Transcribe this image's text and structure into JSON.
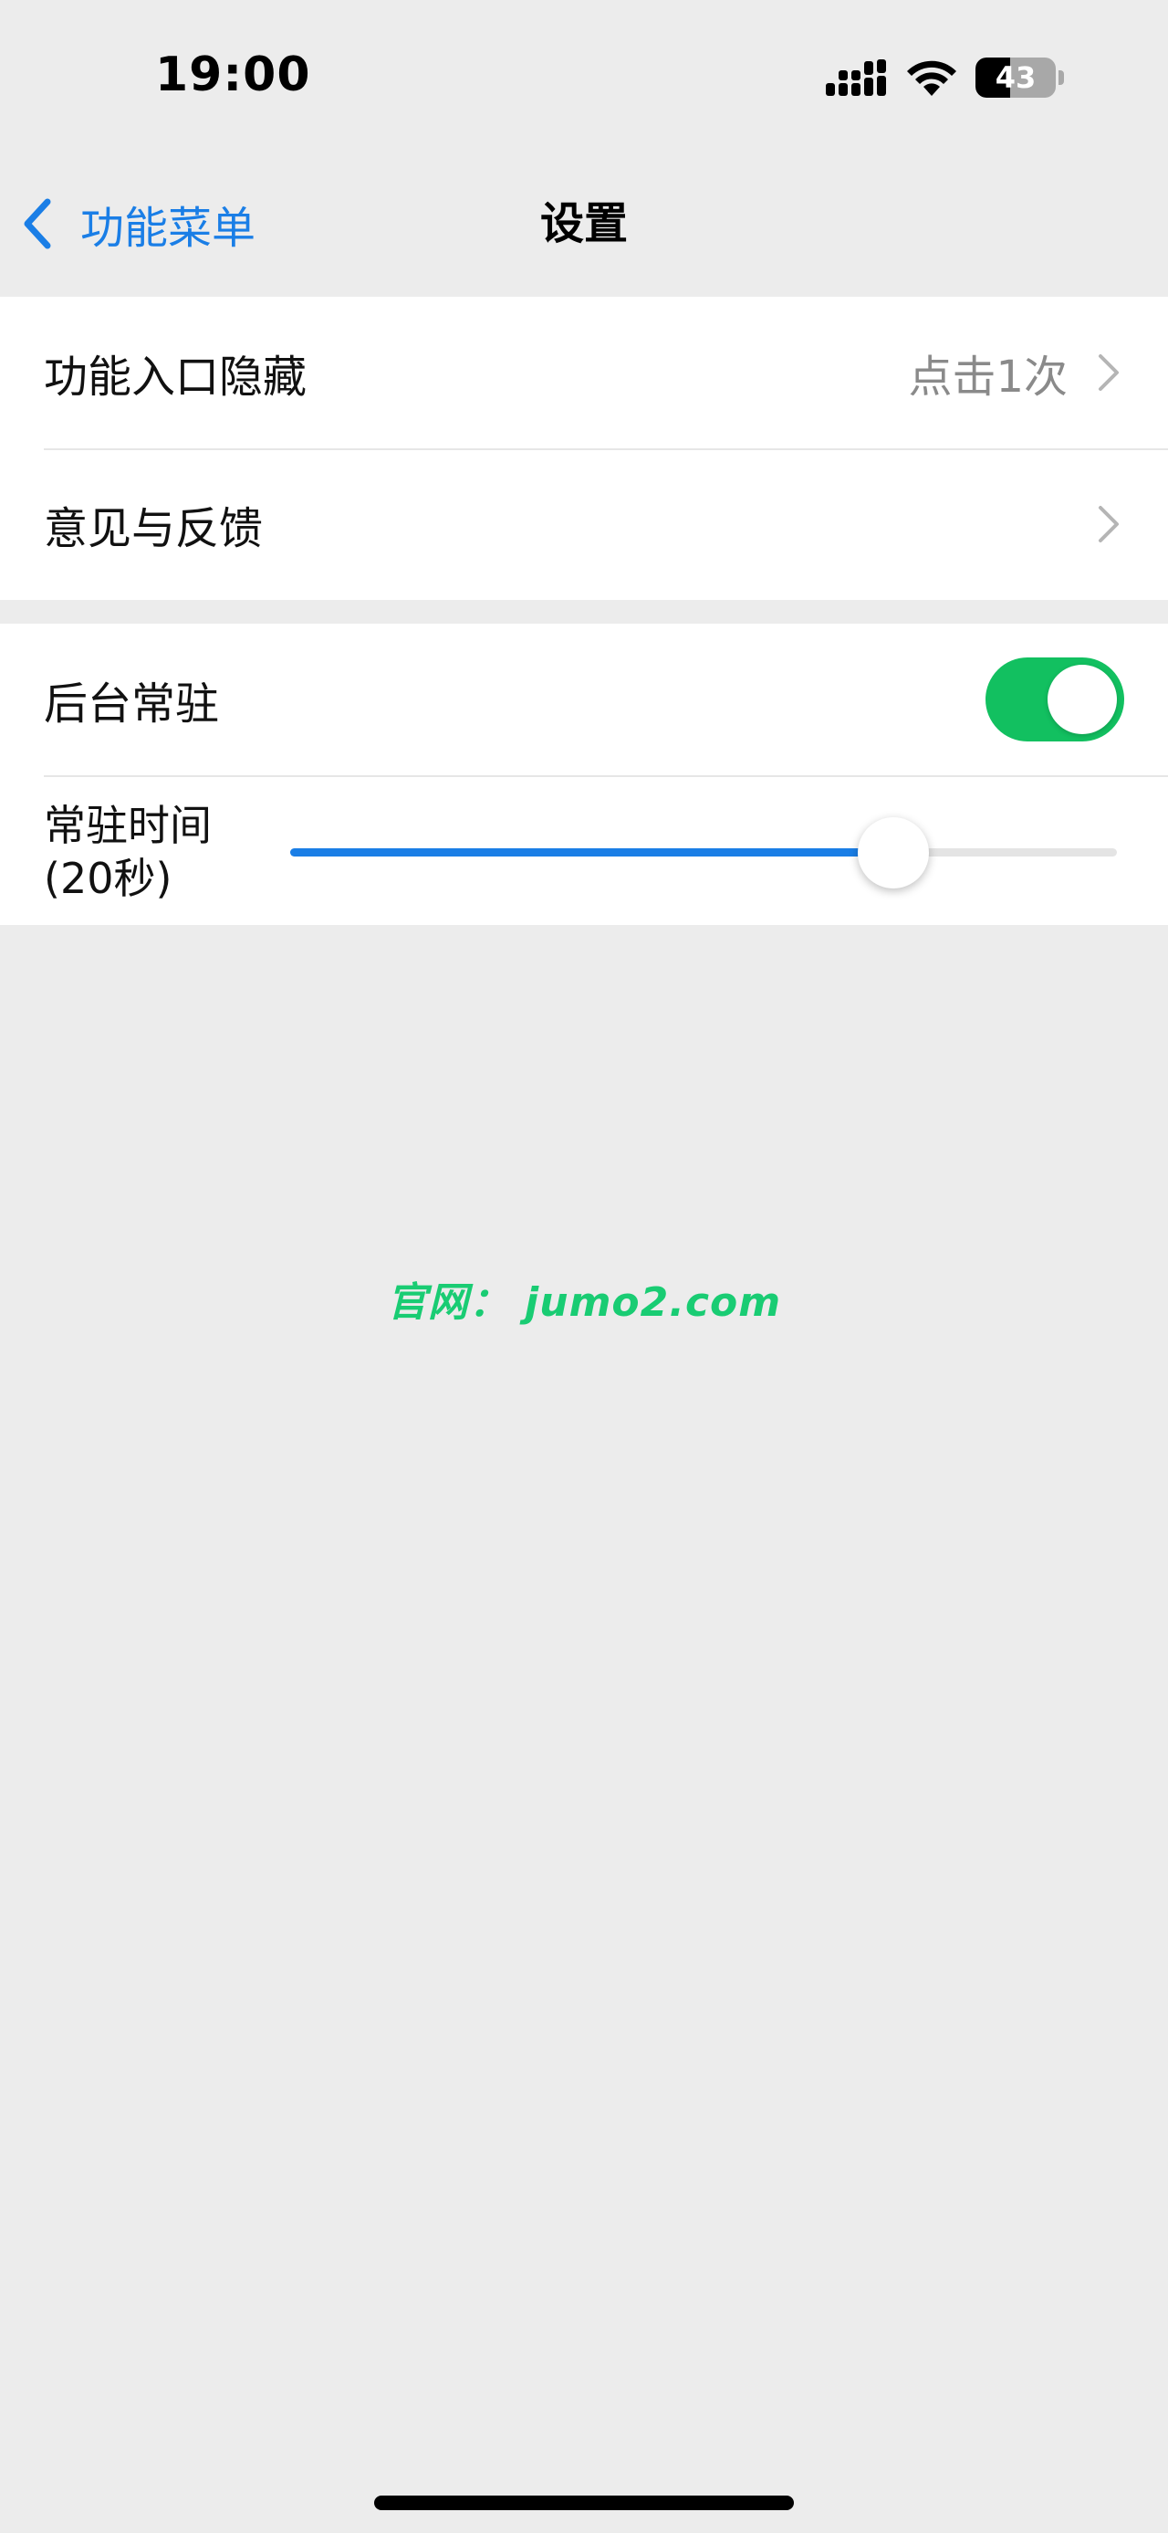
{
  "status_bar": {
    "time": "19:00",
    "signal_icon": "cellular-signal-icon",
    "wifi_icon": "wifi-icon",
    "battery_level": "43",
    "battery_fraction": 0.43
  },
  "nav": {
    "back_label": "功能菜单",
    "back_icon": "chevron-left-icon",
    "title": "设置"
  },
  "settings": {
    "entry_hidden": {
      "label": "功能入口隐藏",
      "value": "点击1次"
    },
    "feedback": {
      "label": "意见与反馈"
    },
    "background_resident": {
      "label": "后台常驻",
      "enabled": true
    },
    "resident_duration": {
      "label_line1": "常驻时间",
      "label_line2": "(20秒)",
      "slider_fraction": 0.73
    }
  },
  "watermark": {
    "text": "官网： jumo2.com"
  },
  "colors": {
    "accent": "#1a7ee6",
    "toggle_on": "#12c060",
    "background": "#ececec",
    "watermark": "#19cc73"
  }
}
